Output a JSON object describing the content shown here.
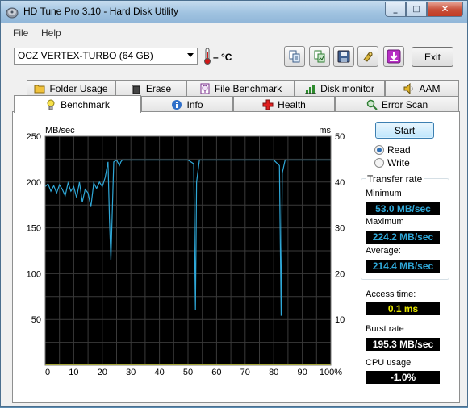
{
  "window": {
    "title": "HD Tune Pro 3.10 - Hard Disk Utility",
    "minimize": "_",
    "maximize": "□",
    "close": "✕"
  },
  "menu": {
    "file": "File",
    "help": "Help"
  },
  "toolbar": {
    "drive": "OCZ VERTEX-TURBO (64 GB)",
    "temperature": "– °C",
    "exit": "Exit",
    "buttons": [
      "copy-text-icon",
      "copy-screenshot-icon",
      "save-icon",
      "options-icon",
      "download-icon"
    ]
  },
  "tabs": {
    "top": [
      "Folder Usage",
      "Erase",
      "File Benchmark",
      "Disk monitor",
      "AAM"
    ],
    "bottom": [
      "Benchmark",
      "Info",
      "Health",
      "Error Scan"
    ],
    "active": "Benchmark"
  },
  "graph": {
    "y_left_unit": "MB/sec",
    "y_right_unit": "ms",
    "y_left_ticks": [
      "250",
      "200",
      "150",
      "100",
      "50"
    ],
    "y_right_ticks": [
      "50",
      "40",
      "30",
      "20",
      "10"
    ],
    "x_ticks": [
      "0",
      "10",
      "20",
      "30",
      "40",
      "50",
      "60",
      "70",
      "80",
      "90",
      "100%"
    ],
    "colors": {
      "background": "#000000",
      "grid": "#3a3a3a",
      "read": "#2fa8d8",
      "access": "#d8d800"
    }
  },
  "controls": {
    "start": "Start",
    "read": "Read",
    "write": "Write",
    "mode": "Read"
  },
  "transfer_rate": {
    "title": "Transfer rate",
    "minimum_label": "Minimum",
    "minimum": "53.0 MB/sec",
    "maximum_label": "Maximum",
    "maximum": "224.2 MB/sec",
    "average_label": "Average:",
    "average": "214.4 MB/sec"
  },
  "stats": {
    "access_label": "Access time:",
    "access": "0.1 ms",
    "burst_label": "Burst rate",
    "burst": "195.3 MB/sec",
    "cpu_label": "CPU usage",
    "cpu": "-1.0%"
  },
  "chart_data": {
    "type": "line",
    "ylabel": "MB/sec",
    "y2label": "ms",
    "ylim": [
      0,
      250
    ],
    "y2lim": [
      0,
      50
    ],
    "xlim": [
      0,
      100
    ],
    "series": [
      {
        "name": "Read",
        "x": [
          0,
          1,
          2,
          3,
          4,
          5,
          6,
          7,
          8,
          9,
          10,
          11,
          12,
          13,
          14,
          15,
          16,
          17,
          18,
          19,
          20,
          21,
          22,
          22.5,
          23,
          24,
          25,
          26,
          26.5,
          27,
          28,
          30,
          40,
          50,
          52,
          52.6,
          53,
          54,
          60,
          70,
          80,
          82,
          82.6,
          83,
          84,
          90,
          100
        ],
        "y": [
          195,
          198,
          190,
          196,
          188,
          197,
          192,
          185,
          199,
          190,
          195,
          183,
          200,
          178,
          192,
          188,
          173,
          199,
          193,
          200,
          195,
          205,
          222,
          160,
          115,
          222,
          224,
          218,
          222,
          224,
          224,
          224,
          224,
          224,
          220,
          60,
          200,
          224,
          224,
          224,
          224,
          218,
          54,
          210,
          224,
          224,
          224
        ]
      },
      {
        "name": "Access time",
        "x": [
          0,
          100
        ],
        "y": [
          0.1,
          0.1
        ]
      }
    ]
  }
}
